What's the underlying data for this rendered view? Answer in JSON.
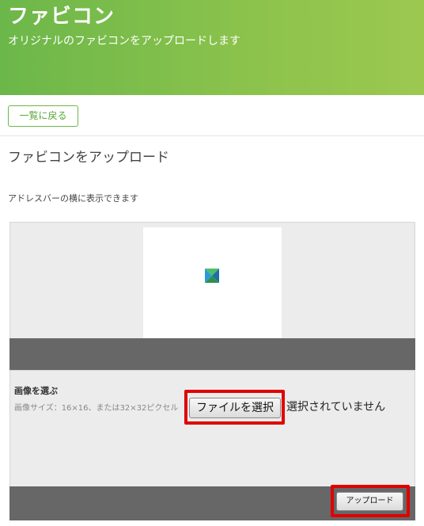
{
  "header": {
    "title": "ファビコン",
    "subtitle": "オリジナルのファビコンをアップロードします"
  },
  "nav": {
    "back_label": "一覧に戻る"
  },
  "section": {
    "title": "ファビコンをアップロード",
    "description": "アドレスバーの横に表示できます"
  },
  "preview": {
    "icon": "favicon-logo-icon"
  },
  "upload": {
    "choose_label": "画像を選ぶ",
    "size_hint": "画像サイズ：16×16、または32×32ピクセル",
    "file_button_label": "ファイルを選択",
    "file_status": "選択されていません",
    "upload_button_label": "アップロード"
  },
  "colors": {
    "header_green": "#8cc34c",
    "accent_green": "#5aa638",
    "highlight_red": "#e00000",
    "panel_gray": "#ececec",
    "bar_gray": "#676767"
  }
}
